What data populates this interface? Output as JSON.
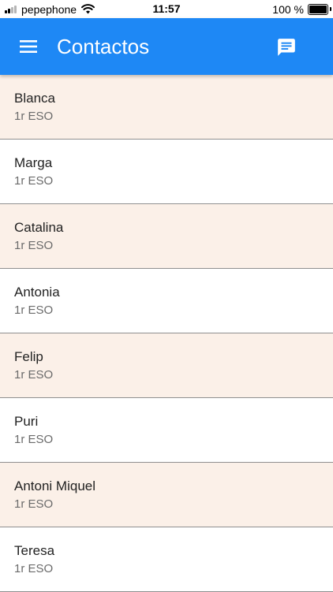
{
  "status_bar": {
    "carrier": "pepephone",
    "time": "11:57",
    "battery": "100 %"
  },
  "app_bar": {
    "title": "Contactos",
    "color": "#1e88f5",
    "menu_icon": "menu-icon",
    "action_icon": "chat-icon"
  },
  "contacts": [
    {
      "name": "Blanca",
      "course": "1r ESO"
    },
    {
      "name": "Marga",
      "course": "1r ESO"
    },
    {
      "name": "Catalina",
      "course": "1r ESO"
    },
    {
      "name": "Antonia",
      "course": "1r ESO"
    },
    {
      "name": "Felip",
      "course": "1r ESO"
    },
    {
      "name": "Puri",
      "course": "1r ESO"
    },
    {
      "name": "Antoni Miquel",
      "course": "1r ESO"
    },
    {
      "name": "Teresa",
      "course": "1r ESO"
    }
  ],
  "colors": {
    "row_alt": "#fbf0e8",
    "row_plain": "#ffffff"
  }
}
